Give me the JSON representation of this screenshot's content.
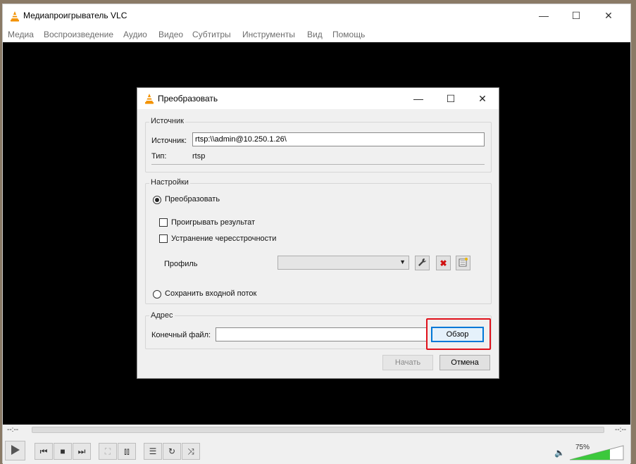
{
  "app": {
    "title": "Медиапроигрыватель VLC"
  },
  "menu": [
    "Медиа",
    "Воспроизведение",
    "Аудио",
    "Видео",
    "Субтитры",
    "Инструменты",
    "Вид",
    "Помощь"
  ],
  "dialog": {
    "title": "Преобразовать",
    "source": {
      "group_title": "Источник",
      "source_label": "Источник:",
      "source_value": "rtsp:\\\\admin@10.250.1.26\\",
      "type_label": "Тип:",
      "type_value": "rtsp"
    },
    "settings": {
      "group_title": "Настройки",
      "convert_label": "Преобразовать",
      "play_result_label": "Проигрывать результат",
      "deinterlace_label": "Устранение чересстрочности",
      "profile_label": "Профиль",
      "profile_value": "",
      "dump_label": "Сохранить входной поток"
    },
    "destination": {
      "group_title": "Адрес",
      "file_label": "Конечный файл:",
      "file_value": "",
      "browse_label": "Обзор"
    },
    "start_label": "Начать",
    "cancel_label": "Отмена"
  },
  "player": {
    "time_elapsed": "--:--",
    "time_total": "--:--",
    "volume": "75%",
    "volume_fraction": 0.75
  },
  "colors": {
    "highlight": "#e0101a",
    "focus": "#0078d7",
    "volume_fill": "#3cc83c"
  }
}
